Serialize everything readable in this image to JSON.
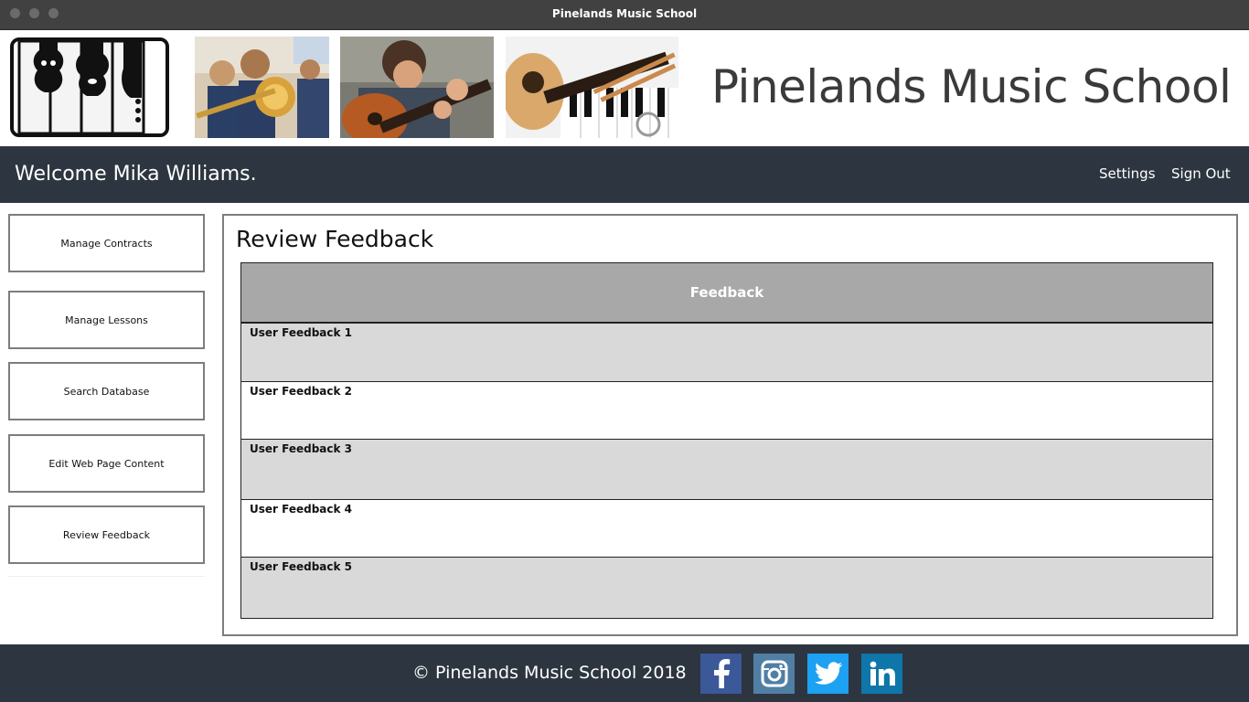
{
  "window": {
    "title": "Pinelands Music School"
  },
  "banner": {
    "school_name": "Pinelands Music School",
    "logo_icon": "piano-violin-logo-icon",
    "photos": [
      "trombone-students-photo",
      "guitar-player-photo",
      "ukulele-piano-photo"
    ]
  },
  "navbar": {
    "welcome": "Welcome Mika Williams.",
    "settings": "Settings",
    "sign_out": "Sign Out"
  },
  "sidebar": {
    "items": [
      {
        "label": "Manage Contracts"
      },
      {
        "label": "Manage Lessons"
      },
      {
        "label": "Search Database"
      },
      {
        "label": "Edit Web Page Content"
      },
      {
        "label": "Review Feedback"
      }
    ]
  },
  "main": {
    "title": "Review Feedback",
    "table": {
      "header": "Feedback",
      "rows": [
        "User Feedback 1",
        "User Feedback 2",
        "User Feedback 3",
        "User Feedback 4",
        "User Feedback 5"
      ]
    }
  },
  "footer": {
    "copyright": "© Pinelands Music School   2018",
    "social": [
      {
        "icon": "facebook-icon",
        "color": "#3b5998"
      },
      {
        "icon": "instagram-icon",
        "color": "#517fa4"
      },
      {
        "icon": "twitter-icon",
        "color": "#1da1f2"
      },
      {
        "icon": "linkedin-icon",
        "color": "#0e76a8"
      }
    ]
  }
}
